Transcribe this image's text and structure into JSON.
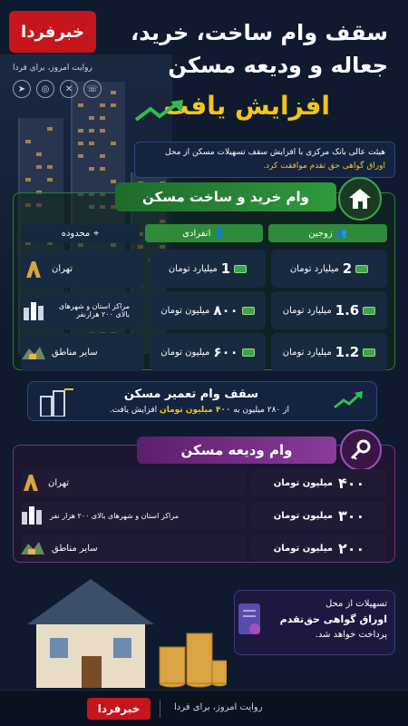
{
  "brand": {
    "logo_text": "خبرفردا",
    "tagline": "روایت امروز، برای فردا"
  },
  "socials": [
    "telegram-icon",
    "instagram-icon",
    "x-icon",
    "phone-icon"
  ],
  "title": {
    "line1": "سقف وام ساخت، خرید،",
    "line2": "جعاله و ودیعه مسکن",
    "line3": "افزایش یافت"
  },
  "intro": {
    "line1": "هیئت عالی بانک مرکزی با افزایش سقف تسهیلات مسکن از محل",
    "line2": "اوراق گواهی حق تقدم موافقت کرد."
  },
  "loan_section": {
    "title": "وام خرید و ساخت مسکن",
    "columns": {
      "region": "محدوده",
      "single": "انفرادی",
      "couples": "زوجین"
    },
    "rows": [
      {
        "region": "تهران",
        "single_num": "1",
        "single_unit": "میلیارد تومان",
        "couples_num": "2",
        "couples_unit": "میلیارد تومان"
      },
      {
        "region": "مراکز استان و شهرهای بالای ۲۰۰ هزارنفر",
        "single_num": "۸۰۰",
        "single_unit": "میلیون تومان",
        "couples_num": "1.6",
        "couples_unit": "میلیارد تومان"
      },
      {
        "region": "سایر مناطق",
        "single_num": "۶۰۰",
        "single_unit": "میلیون تومان",
        "couples_num": "1.2",
        "couples_unit": "میلیارد تومان"
      }
    ]
  },
  "repair": {
    "title": "سقف وام تعمیر مسکن",
    "text_pre": "از ۲۸۰ میلیون به",
    "text_hl": "۴۰۰ میلیون تومان",
    "text_post": "افزایش یافت."
  },
  "deposit_section": {
    "title": "وام ودیعه مسکن",
    "rows": [
      {
        "region": "تهران",
        "num": "۴۰۰",
        "unit": "میلیون تومان"
      },
      {
        "region": "مراکز استان و شهرهای بالای ۲۰۰ هزار نفر",
        "num": "۳۰۰",
        "unit": "میلیون تومان"
      },
      {
        "region": "سایر مناطق",
        "num": "۲۰۰",
        "unit": "میلیون تومان"
      }
    ]
  },
  "note": {
    "line1": "تسهیلات از محل",
    "line2": "اوراق گواهی حق‌تقدم",
    "line3": "پرداخت خواهد شد."
  },
  "colors": {
    "accent_yellow": "#f5c518",
    "green": "#2e8b3a",
    "purple": "#8a3b9b",
    "brand_red": "#c4161c"
  }
}
